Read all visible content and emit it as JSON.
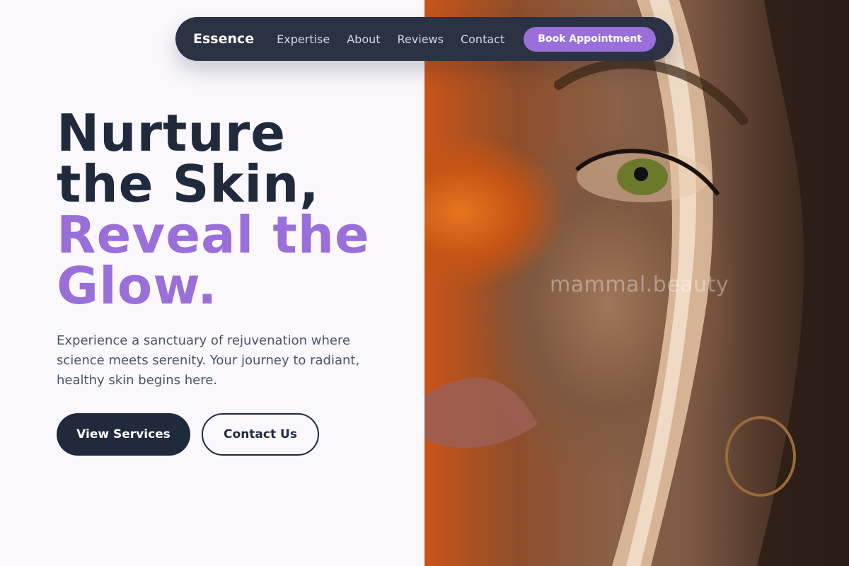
{
  "nav": {
    "logo": "Essence",
    "links": [
      "Expertise",
      "About",
      "Reviews",
      "Contact"
    ],
    "cta": "Book Appointment"
  },
  "hero": {
    "headline_dark_1": "Nurture",
    "headline_dark_2": "the Skin,",
    "headline_accent_1": "Reveal the",
    "headline_accent_2": "Glow.",
    "subtext": "Experience a sanctuary of rejuvenation where science meets serenity. Your journey to radiant, healthy skin begins here.",
    "primary_button": "View Services",
    "secondary_button": "Contact Us"
  },
  "image": {
    "watermark": "mammal.beauty"
  },
  "colors": {
    "navy": "#1f2a3d",
    "accent_purple": "#9a6fd9",
    "page_bg": "#fbf8fd"
  }
}
